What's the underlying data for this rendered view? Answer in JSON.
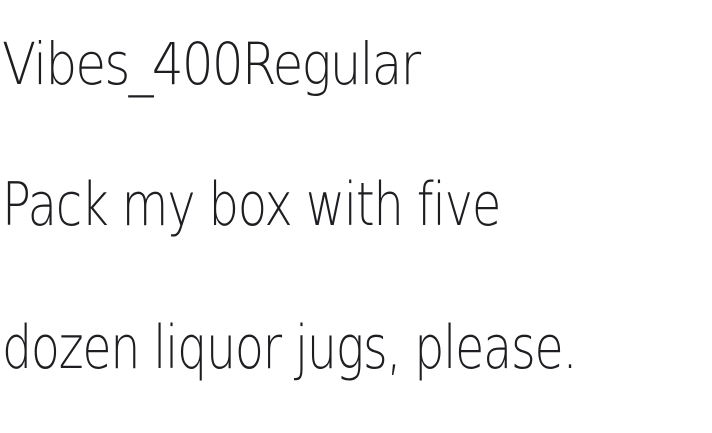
{
  "specimen": {
    "font_name": "Vibes_400Regular",
    "sample_line_1": "Pack my box with five",
    "sample_line_2": "dozen liquor jugs, please."
  },
  "colors": {
    "background": "#ffffff",
    "text": "#1e1e22"
  }
}
